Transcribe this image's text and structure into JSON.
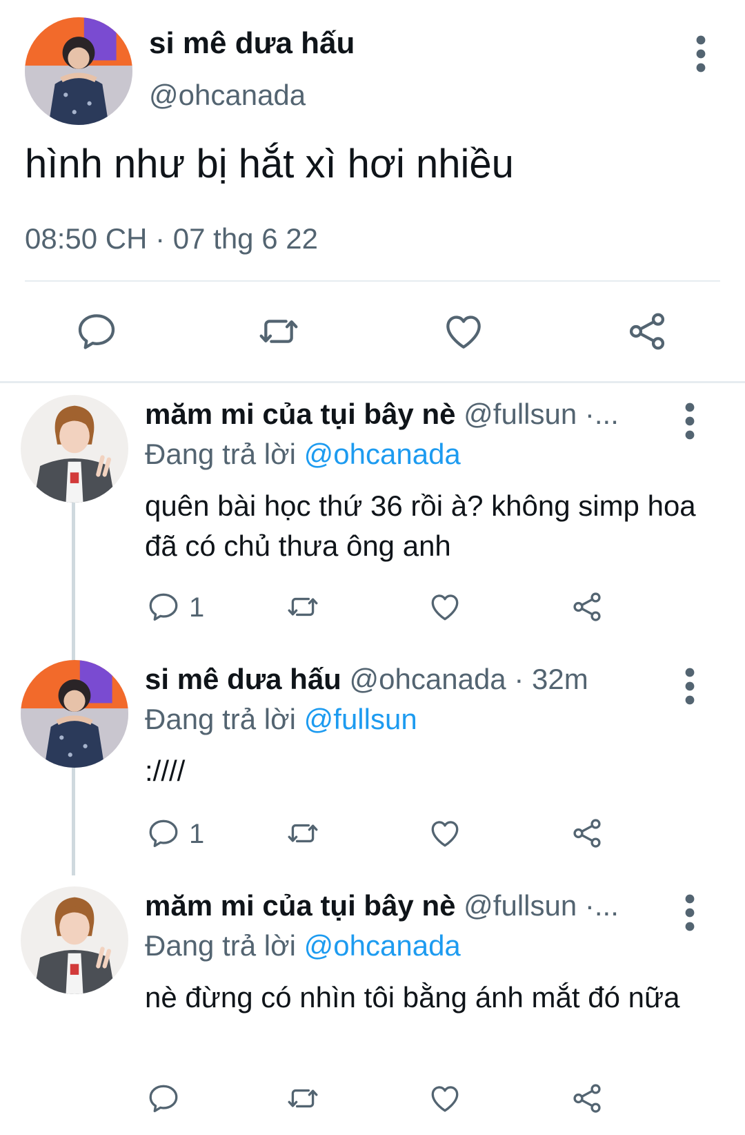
{
  "main_tweet": {
    "author_name": "si mê dưa hấu",
    "handle": "@ohcanada",
    "text": "hình như bị hắt xì hơi nhiều",
    "timestamp": "08:50 CH · 07 thg 6 22",
    "actions": [
      "reply-icon",
      "retweet-icon",
      "like-icon",
      "share-icon"
    ]
  },
  "replies": [
    {
      "author_name": "măm mi của tụi bây nè",
      "meta": "@fullsun ·...",
      "replying_label": "Đang trả lời",
      "replying_to": "@ohcanada",
      "text": "quên bài học thứ 36 rồi à? không simp hoa đã có chủ thưa ông anh",
      "reply_count": "1"
    },
    {
      "author_name": "si mê dưa hấu",
      "meta": "@ohcanada · 32m",
      "replying_label": "Đang trả lời",
      "replying_to": "@fullsun",
      "text": ":////",
      "reply_count": "1"
    },
    {
      "author_name": "măm mi của tụi bây nè",
      "meta": "@fullsun ·...",
      "replying_label": "Đang trả lời",
      "replying_to": "@ohcanada",
      "text": "nè đừng có nhìn tôi bằng ánh mắt đó nữa",
      "reply_count": ""
    }
  ],
  "colors": {
    "text_primary": "#0f1419",
    "text_secondary": "#536471",
    "mention": "#1d9bf0",
    "divider": "#e6ecf0",
    "thread_line": "#cfd9de"
  }
}
